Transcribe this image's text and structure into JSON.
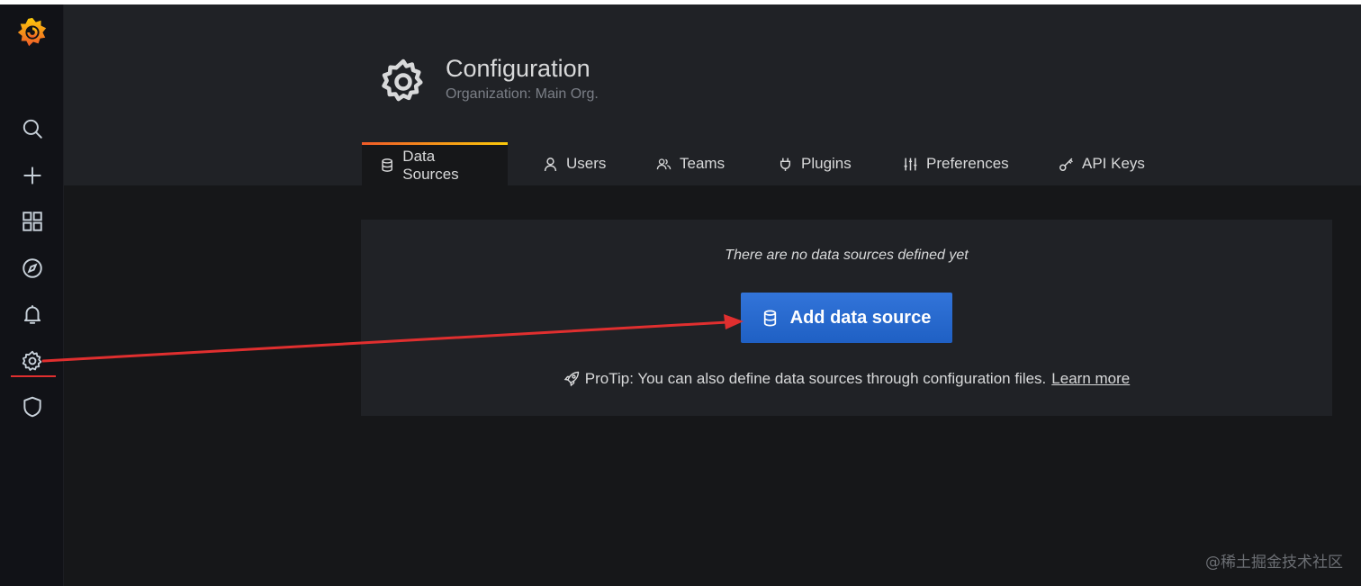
{
  "page": {
    "title": "Configuration",
    "subtitle": "Organization: Main Org."
  },
  "tabs": [
    {
      "label": "Data Sources",
      "icon": "database-icon",
      "active": true
    },
    {
      "label": "Users",
      "icon": "user-icon",
      "active": false
    },
    {
      "label": "Teams",
      "icon": "users-icon",
      "active": false
    },
    {
      "label": "Plugins",
      "icon": "plug-icon",
      "active": false
    },
    {
      "label": "Preferences",
      "icon": "sliders-icon",
      "active": false
    },
    {
      "label": "API Keys",
      "icon": "key-icon",
      "active": false
    }
  ],
  "empty_state": {
    "message": "There are no data sources defined yet",
    "add_button": "Add data source",
    "protip": "ProTip: You can also define data sources through configuration files.",
    "learn_more": "Learn more"
  },
  "sidebar": {
    "items": [
      "grafana-logo",
      "search-icon",
      "plus-icon",
      "dashboards-icon",
      "explore-icon",
      "alerting-icon",
      "configuration-icon",
      "shield-icon"
    ],
    "active": "configuration-icon"
  },
  "watermark": "@稀土掘金技术社区",
  "colors": {
    "background": "#161719",
    "panel": "#202226",
    "primary_button": "#3274d9",
    "annotation_red": "#e02f2f"
  }
}
